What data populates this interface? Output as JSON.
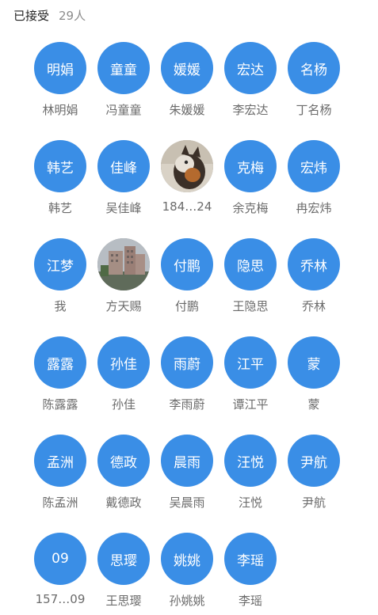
{
  "header": {
    "title": "已接受",
    "count": "29人"
  },
  "members": [
    {
      "avatar": "明娟",
      "name": "林明娟"
    },
    {
      "avatar": "童童",
      "name": "冯童童"
    },
    {
      "avatar": "媛媛",
      "name": "朱媛媛"
    },
    {
      "avatar": "宏达",
      "name": "李宏达"
    },
    {
      "avatar": "名杨",
      "name": "丁名杨"
    },
    {
      "avatar": "韩艺",
      "name": "韩艺"
    },
    {
      "avatar": "佳峰",
      "name": "吴佳峰"
    },
    {
      "avatar": "",
      "photo": "cat-photo",
      "name": "184…24"
    },
    {
      "avatar": "克梅",
      "name": "余克梅"
    },
    {
      "avatar": "宏炜",
      "name": "冉宏炜"
    },
    {
      "avatar": "江梦",
      "name": "我"
    },
    {
      "avatar": "",
      "photo": "building-photo",
      "name": "方天赐"
    },
    {
      "avatar": "付鹏",
      "name": "付鹏"
    },
    {
      "avatar": "隐思",
      "name": "王隐思"
    },
    {
      "avatar": "乔林",
      "name": "乔林"
    },
    {
      "avatar": "露露",
      "name": "陈露露"
    },
    {
      "avatar": "孙佳",
      "name": "孙佳"
    },
    {
      "avatar": "雨蔚",
      "name": "李雨蔚"
    },
    {
      "avatar": "江平",
      "name": "谭江平"
    },
    {
      "avatar": "蒙",
      "name": "蒙"
    },
    {
      "avatar": "孟洲",
      "name": "陈孟洲"
    },
    {
      "avatar": "德政",
      "name": "戴德政"
    },
    {
      "avatar": "晨雨",
      "name": "吴晨雨"
    },
    {
      "avatar": "汪悦",
      "name": "汪悦"
    },
    {
      "avatar": "尹航",
      "name": "尹航"
    },
    {
      "avatar": "09",
      "name": "157…09"
    },
    {
      "avatar": "思璎",
      "name": "王思璎"
    },
    {
      "avatar": "姚姚",
      "name": "孙姚姚"
    },
    {
      "avatar": "李瑶",
      "name": "李瑶"
    }
  ],
  "colors": {
    "avatar_bg": "#3a8ee6",
    "name_text": "#6b6b6b",
    "title_text": "#222222",
    "count_text": "#8c8c8c"
  }
}
